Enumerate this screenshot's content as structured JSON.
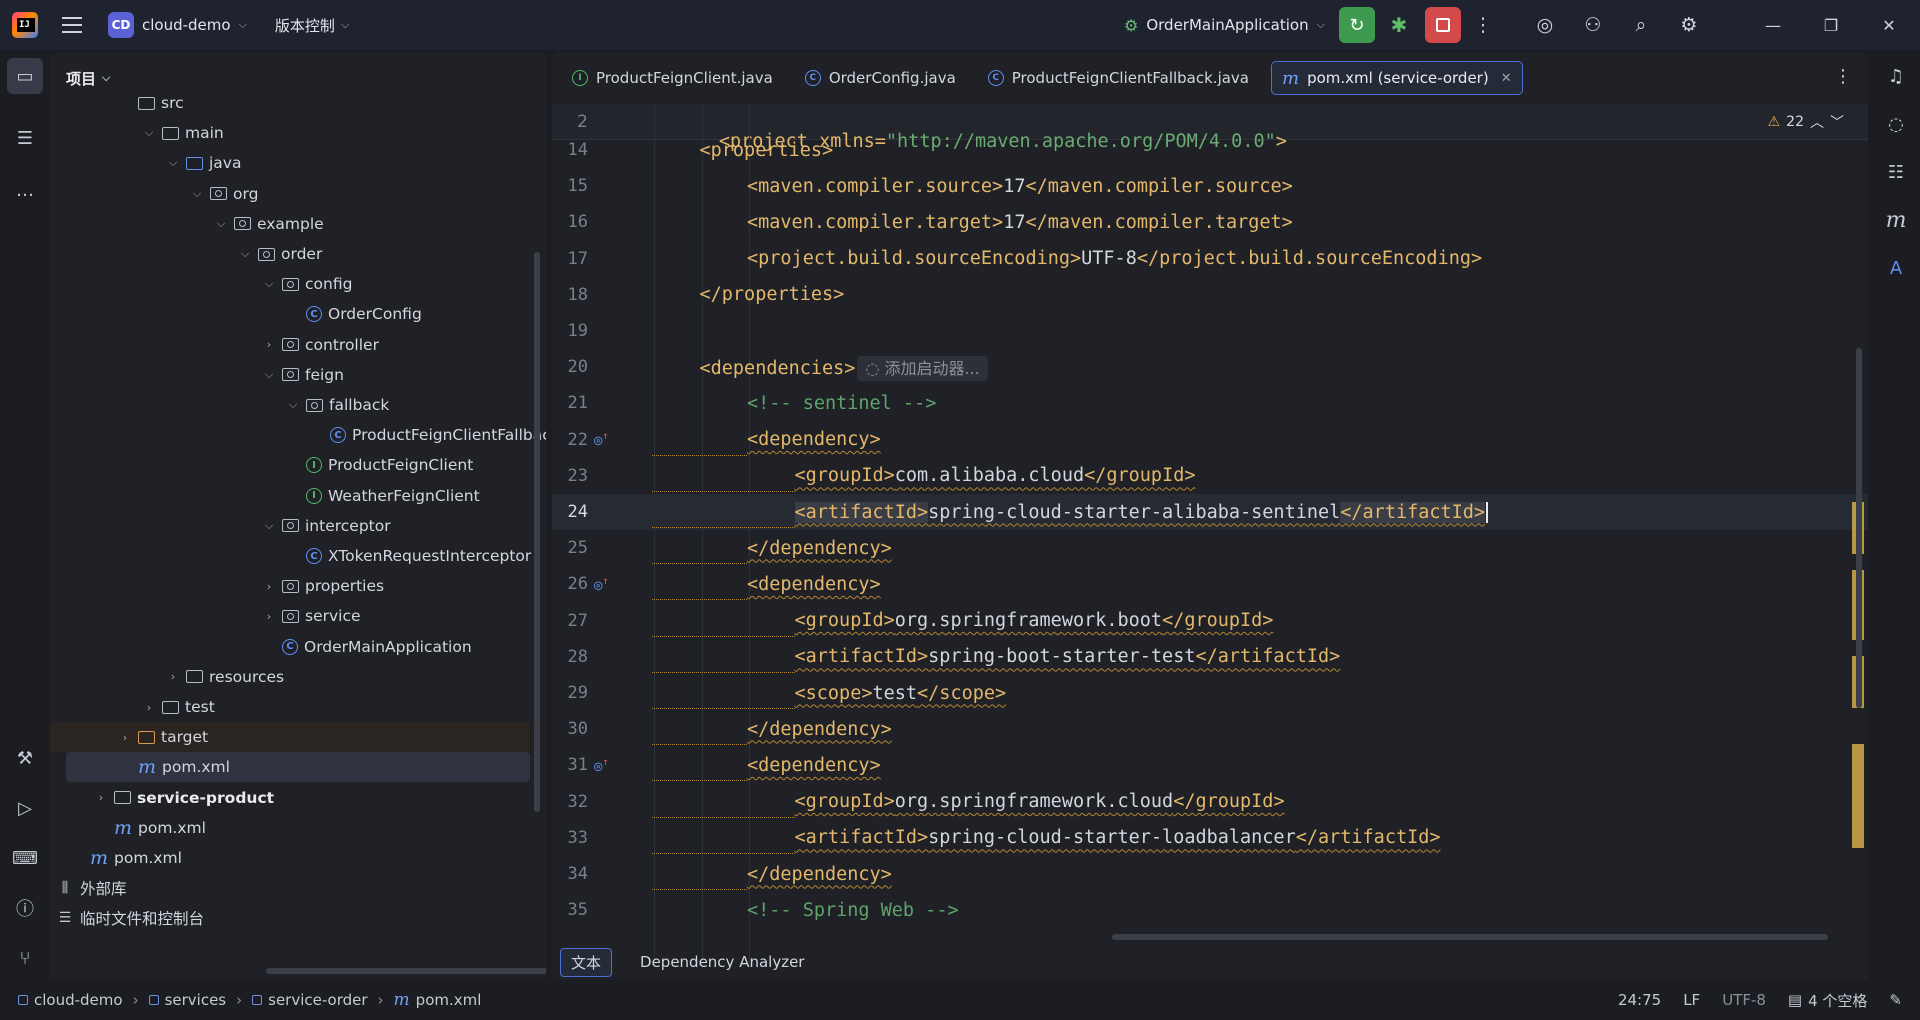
{
  "titlebar": {
    "project_badge": "CD",
    "project_name": "cloud-demo",
    "vcs_label": "版本控制",
    "run_config": "OrderMainApplication"
  },
  "project_panel": {
    "title": "项目",
    "tree": [
      {
        "label": "src",
        "indent": 2,
        "arrow": "",
        "icon": "folder"
      },
      {
        "label": "main",
        "indent": 3,
        "arrow": "open",
        "icon": "folder"
      },
      {
        "label": "java",
        "indent": 4,
        "arrow": "open",
        "icon": "folder-blue"
      },
      {
        "label": "org",
        "indent": 5,
        "arrow": "open",
        "icon": "package"
      },
      {
        "label": "example",
        "indent": 6,
        "arrow": "open",
        "icon": "package"
      },
      {
        "label": "order",
        "indent": 7,
        "arrow": "open",
        "icon": "package"
      },
      {
        "label": "config",
        "indent": 8,
        "arrow": "open",
        "icon": "package"
      },
      {
        "label": "OrderConfig",
        "indent": 9,
        "arrow": "",
        "icon": "class"
      },
      {
        "label": "controller",
        "indent": 8,
        "arrow": "closed",
        "icon": "package"
      },
      {
        "label": "feign",
        "indent": 8,
        "arrow": "open",
        "icon": "package"
      },
      {
        "label": "fallback",
        "indent": 9,
        "arrow": "open",
        "icon": "package"
      },
      {
        "label": "ProductFeignClientFallback",
        "indent": 10,
        "arrow": "",
        "icon": "class"
      },
      {
        "label": "ProductFeignClient",
        "indent": 9,
        "arrow": "",
        "icon": "interface"
      },
      {
        "label": "WeatherFeignClient",
        "indent": 9,
        "arrow": "",
        "icon": "interface"
      },
      {
        "label": "interceptor",
        "indent": 8,
        "arrow": "open",
        "icon": "package"
      },
      {
        "label": "XTokenRequestInterceptor",
        "indent": 9,
        "arrow": "",
        "icon": "class"
      },
      {
        "label": "properties",
        "indent": 8,
        "arrow": "closed",
        "icon": "package"
      },
      {
        "label": "service",
        "indent": 8,
        "arrow": "closed",
        "icon": "package"
      },
      {
        "label": "OrderMainApplication",
        "indent": 8,
        "arrow": "",
        "icon": "class-app"
      },
      {
        "label": "resources",
        "indent": 4,
        "arrow": "closed",
        "icon": "folder-res"
      },
      {
        "label": "test",
        "indent": 3,
        "arrow": "closed",
        "icon": "folder"
      },
      {
        "label": "target",
        "indent": 2,
        "arrow": "closed",
        "icon": "folder-orange",
        "state": "excluded"
      },
      {
        "label": "pom.xml",
        "indent": 2,
        "arrow": "",
        "icon": "maven",
        "state": "selected"
      },
      {
        "label": "service-product",
        "indent": 1,
        "arrow": "closed",
        "icon": "module",
        "bold": true
      },
      {
        "label": "pom.xml",
        "indent": 1,
        "arrow": "",
        "icon": "maven"
      },
      {
        "label": "pom.xml",
        "indent": 0,
        "arrow": "",
        "icon": "maven"
      },
      {
        "label": "外部库",
        "indent": -1,
        "arrow": "",
        "icon": "library"
      },
      {
        "label": "临时文件和控制台",
        "indent": -1,
        "arrow": "",
        "icon": "scratch"
      }
    ]
  },
  "editor": {
    "tabs": [
      {
        "label": "ProductFeignClient.java",
        "icon": "interface"
      },
      {
        "label": "OrderConfig.java",
        "icon": "class"
      },
      {
        "label": "ProductFeignClientFallback.java",
        "icon": "class"
      },
      {
        "label": "pom.xml (service-order)",
        "icon": "maven",
        "active": true
      }
    ],
    "warning_count": "22",
    "inline_hint": "添加启动器...",
    "sticky_line": {
      "num": "2",
      "pre": "<project xmlns=",
      "str": "\"http://maven.apache.org/POM/4.0.0\""
    },
    "lines": [
      {
        "num": "14",
        "indent": 1,
        "open": "<properties>",
        "text": "",
        "close": ""
      },
      {
        "num": "15",
        "indent": 2,
        "open": "<maven.compiler.source>",
        "text": "17",
        "close": "</maven.compiler.source>"
      },
      {
        "num": "16",
        "indent": 2,
        "open": "<maven.compiler.target>",
        "text": "17",
        "close": "</maven.compiler.target>"
      },
      {
        "num": "17",
        "indent": 2,
        "open": "<project.build.sourceEncoding>",
        "text": "UTF-8",
        "close": "</project.build.sourceEncoding>"
      },
      {
        "num": "18",
        "indent": 1,
        "open": "</properties>",
        "text": "",
        "close": ""
      },
      {
        "num": "19",
        "indent": 0,
        "open": "",
        "text": "",
        "close": ""
      },
      {
        "num": "20",
        "indent": 1,
        "open": "<dependencies>",
        "text": "",
        "close": "",
        "hint": true
      },
      {
        "num": "21",
        "indent": 2,
        "comment": "<!-- sentinel -->"
      },
      {
        "num": "22",
        "indent": 2,
        "open": "<dependency>",
        "text": "",
        "close": "",
        "wavy": true,
        "mark": true
      },
      {
        "num": "23",
        "indent": 3,
        "open": "<groupId>",
        "text": "com.alibaba.cloud",
        "close": "</groupId>",
        "wavy": true
      },
      {
        "num": "24",
        "indent": 3,
        "open": "<artifactId>",
        "text": "spring-cloud-starter-alibaba-sentinel",
        "close": "</artifactId>",
        "wavy": true,
        "current": true
      },
      {
        "num": "25",
        "indent": 2,
        "open": "</dependency>",
        "text": "",
        "close": "",
        "wavy": true
      },
      {
        "num": "26",
        "indent": 2,
        "open": "<dependency>",
        "text": "",
        "close": "",
        "wavy": true,
        "mark": true
      },
      {
        "num": "27",
        "indent": 3,
        "open": "<groupId>",
        "text": "org.springframework.boot",
        "close": "</groupId>",
        "wavy": true
      },
      {
        "num": "28",
        "indent": 3,
        "open": "<artifactId>",
        "text": "spring-boot-starter-test",
        "close": "</artifactId>",
        "wavy": true
      },
      {
        "num": "29",
        "indent": 3,
        "open": "<scope>",
        "text": "test",
        "close": "</scope>",
        "wavy": true
      },
      {
        "num": "30",
        "indent": 2,
        "open": "</dependency>",
        "text": "",
        "close": "",
        "wavy": true
      },
      {
        "num": "31",
        "indent": 2,
        "open": "<dependency>",
        "text": "",
        "close": "",
        "wavy": true,
        "mark": true
      },
      {
        "num": "32",
        "indent": 3,
        "open": "<groupId>",
        "text": "org.springframework.cloud",
        "close": "</groupId>",
        "wavy": true
      },
      {
        "num": "33",
        "indent": 3,
        "open": "<artifactId>",
        "text": "spring-cloud-starter-loadbalancer",
        "close": "</artifactId>",
        "wavy": true
      },
      {
        "num": "34",
        "indent": 2,
        "open": "</dependency>",
        "text": "",
        "close": "",
        "wavy": true
      },
      {
        "num": "35",
        "indent": 2,
        "comment": "<!-- Spring Web -->"
      }
    ],
    "bottom_tabs": [
      {
        "label": "文本",
        "active": true
      },
      {
        "label": "Dependency Analyzer",
        "active": false
      }
    ]
  },
  "statusbar": {
    "breadcrumbs": [
      "cloud-demo",
      "services",
      "service-order",
      "pom.xml"
    ],
    "position": "24:75",
    "line_sep": "LF",
    "encoding": "UTF-8",
    "indent": "4 个空格"
  }
}
